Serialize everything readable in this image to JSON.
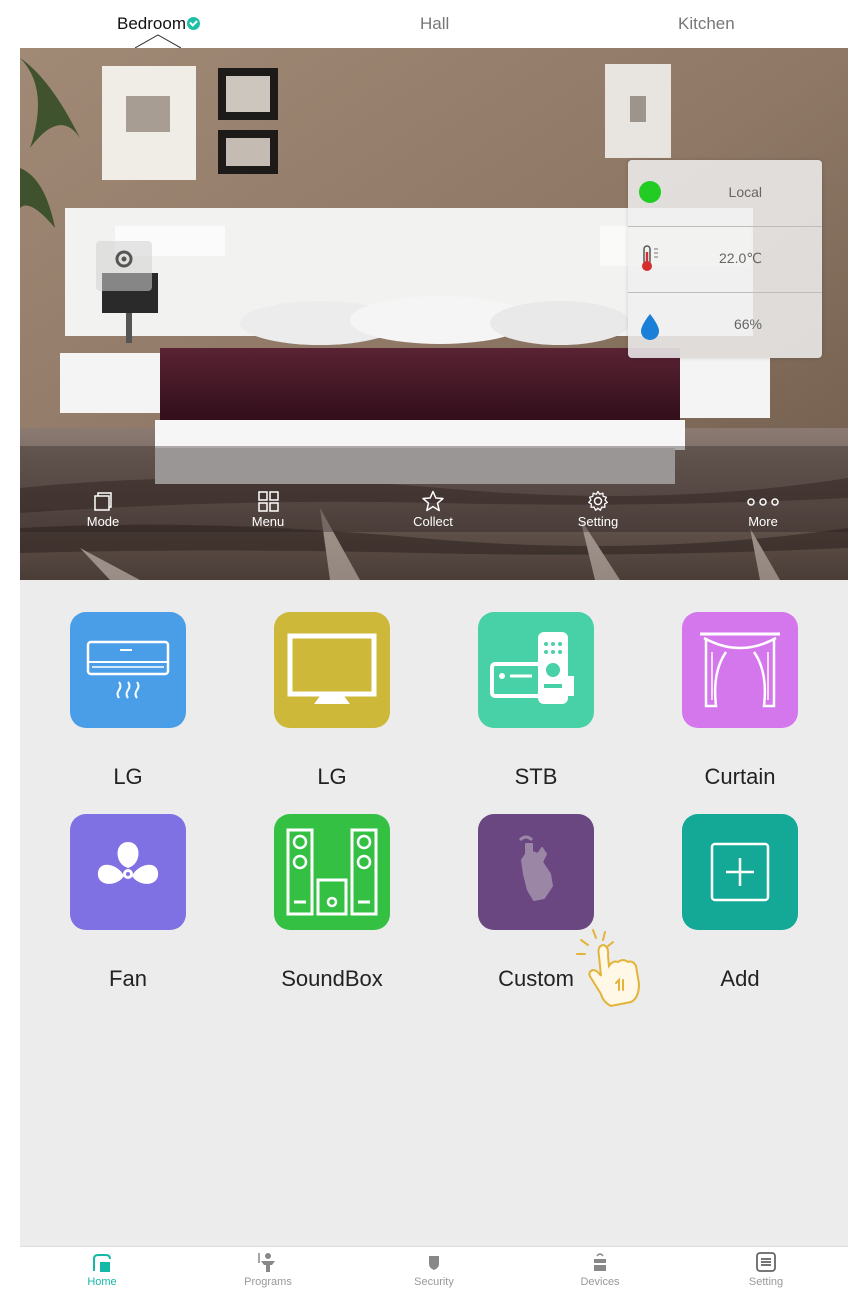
{
  "room_tabs": [
    {
      "label": "Bedroom",
      "active": true
    },
    {
      "label": "Hall",
      "active": false
    },
    {
      "label": "Kitchen",
      "active": false
    }
  ],
  "status_panel": {
    "connection": "Local",
    "temperature": "22.0℃",
    "humidity": "66%"
  },
  "hero_toolbar": [
    {
      "label": "Mode",
      "icon": "mode-icon"
    },
    {
      "label": "Menu",
      "icon": "grid-icon"
    },
    {
      "label": "Collect",
      "icon": "star-icon"
    },
    {
      "label": "Setting",
      "icon": "gear-icon"
    },
    {
      "label": "More",
      "icon": "more-dots-icon"
    }
  ],
  "devices": [
    {
      "label": "LG",
      "icon": "air-conditioner-icon",
      "color": "#4a9ee8"
    },
    {
      "label": "LG",
      "icon": "tv-icon",
      "color": "#cdb83a"
    },
    {
      "label": "STB",
      "icon": "set-top-box-icon",
      "color": "#48d0a6"
    },
    {
      "label": "Curtain",
      "icon": "curtain-icon",
      "color": "#d477ec"
    },
    {
      "label": "Fan",
      "icon": "fan-icon",
      "color": "#7f71e3"
    },
    {
      "label": "SoundBox",
      "icon": "speakers-icon",
      "color": "#33c043"
    },
    {
      "label": "Custom",
      "icon": "custom-remote-icon",
      "color": "#6b4782"
    },
    {
      "label": "Add",
      "icon": "add-icon",
      "color": "#14a896"
    }
  ],
  "bottom_nav": [
    {
      "label": "Home",
      "icon": "home-icon",
      "active": true
    },
    {
      "label": "Programs",
      "icon": "programs-icon",
      "active": false
    },
    {
      "label": "Security",
      "icon": "shield-icon",
      "active": false
    },
    {
      "label": "Devices",
      "icon": "devices-icon",
      "active": false
    },
    {
      "label": "Setting",
      "icon": "setting-list-icon",
      "active": false
    }
  ],
  "colors": {
    "accent": "#14b8a6",
    "status_online": "#22cc22",
    "humidity": "#1a7fd6"
  }
}
